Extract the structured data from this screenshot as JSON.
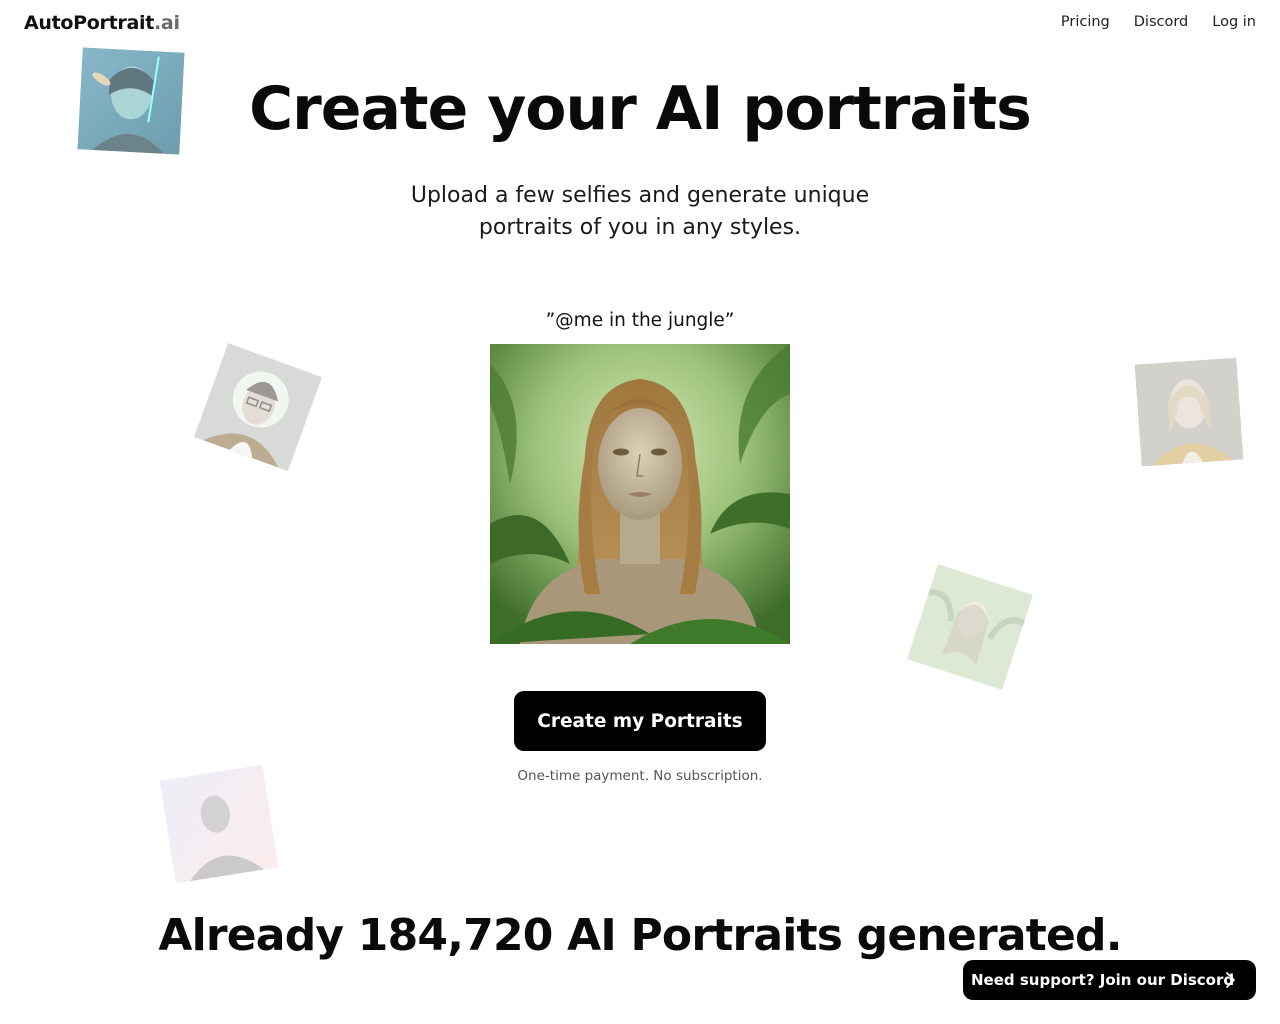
{
  "nav": {
    "logo_main": "AutoPortrait",
    "logo_tld": ".ai",
    "links": [
      {
        "label": "Pricing"
      },
      {
        "label": "Discord"
      },
      {
        "label": "Log in"
      }
    ]
  },
  "hero": {
    "title": "Create your AI portraits",
    "subtitle": "Upload a few selfies and generate unique portraits of you in any styles."
  },
  "showcase": {
    "prompt": "”@me in the jungle”",
    "image_alt": "AI portrait of a woman in the jungle"
  },
  "cta": {
    "button_label": "Create my Portraits",
    "note": "One-time payment. No subscription."
  },
  "stats": {
    "text": "Already 184,720 AI Portraits generated."
  },
  "support": {
    "label": "Need support? Join our Discord",
    "icon": "chevron-right-icon"
  },
  "floating_portraits": [
    {
      "name": "cyberpunk-portrait"
    },
    {
      "name": "beanie-glasses-portrait"
    },
    {
      "name": "renaissance-portrait"
    },
    {
      "name": "jungle-portrait"
    },
    {
      "name": "pastel-portrait"
    }
  ],
  "colors": {
    "primary": "#000000",
    "background": "#ffffff",
    "muted_text": "#555555"
  }
}
